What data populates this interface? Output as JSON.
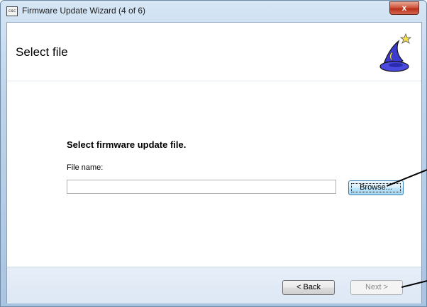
{
  "window": {
    "title": "Firmware Update Wizard (4 of 6)",
    "app_icon_text": "csc",
    "close_label": "x"
  },
  "header": {
    "page_title": "Select file",
    "wizard_icon": "wizard-hat-icon"
  },
  "content": {
    "heading": "Select firmware update file.",
    "file_label": "File name:",
    "file_value": "",
    "browse_label": "Browse..."
  },
  "footer": {
    "back_label": "< Back",
    "next_label": "Next >",
    "next_enabled": false
  }
}
